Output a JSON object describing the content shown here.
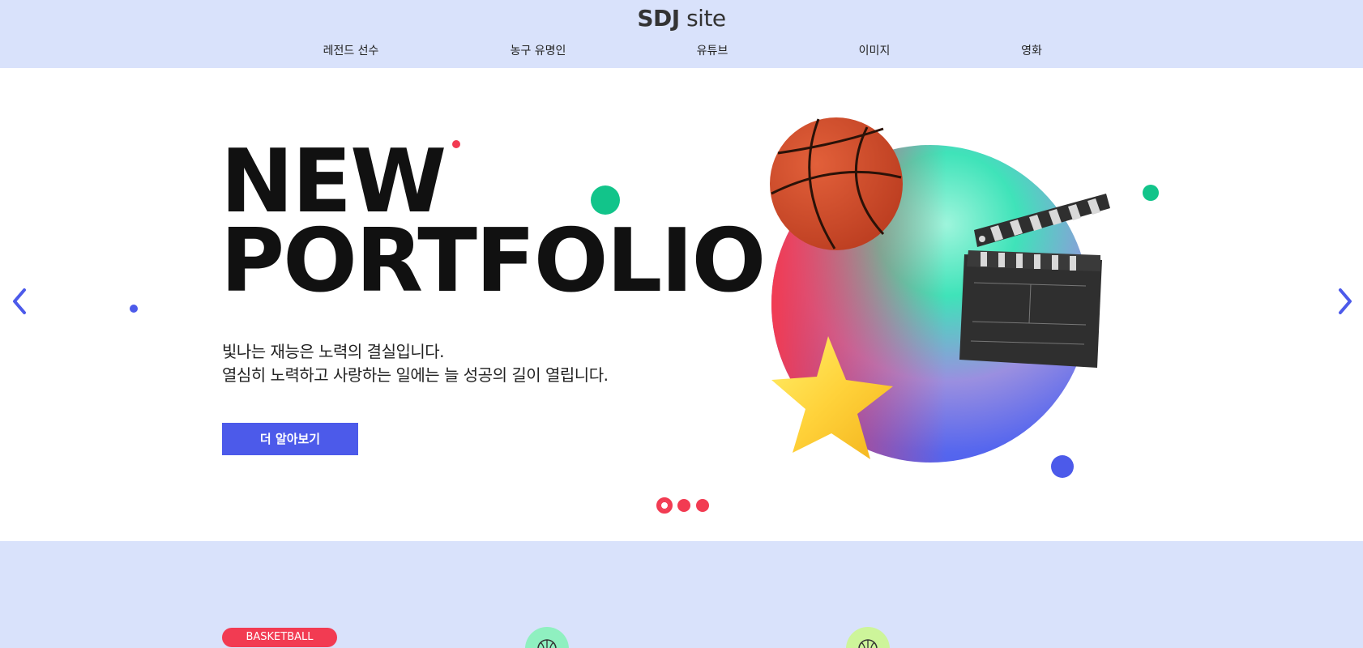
{
  "header": {
    "logo_bold": "SDJ",
    "logo_light": " site",
    "nav": [
      {
        "label": "레전드 선수"
      },
      {
        "label": "농구 유명인"
      },
      {
        "label": "유튜브"
      },
      {
        "label": "이미지"
      },
      {
        "label": "영화"
      }
    ]
  },
  "hero": {
    "headline_line1": "NEW",
    "headline_line2": "PORTFOLIO",
    "desc_line1": "빛나는 재능은 노력의 결실입니다.",
    "desc_line2": "열심히 노력하고 사랑하는 일에는 늘 성공의 길이 열립니다.",
    "cta_label": "더 알아보기",
    "prev_icon": "chevron-left-icon",
    "next_icon": "chevron-right-icon",
    "slide_count": 3,
    "active_slide": 1
  },
  "section2": {
    "badge_label": "BASKETBALL",
    "card_icons": [
      "basketball-icon",
      "basketball-icon"
    ]
  },
  "colors": {
    "accent_blue": "#4c5aea",
    "accent_red": "#f23b52",
    "accent_green": "#12c48a",
    "header_bg": "#d9e2fb"
  }
}
